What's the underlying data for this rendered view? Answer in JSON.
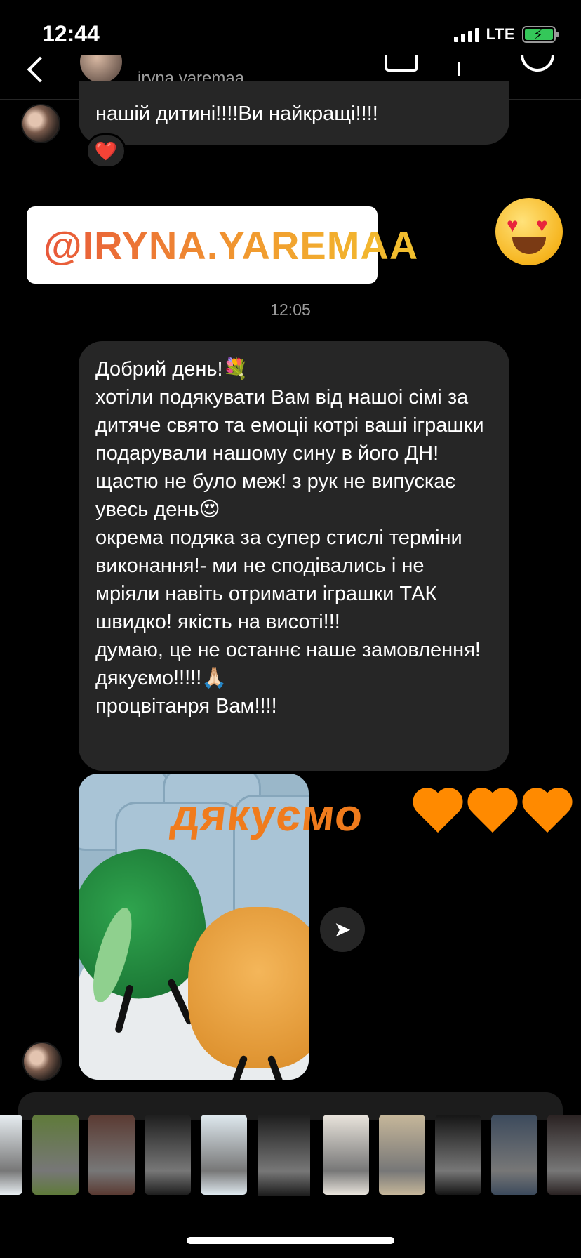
{
  "status_bar": {
    "time": "12:44",
    "network": "LTE",
    "battery_charging": true
  },
  "header": {
    "username": "iryna.yaremaa",
    "icons": [
      "back-icon",
      "video-call-icon",
      "info-icon",
      "emoji-icon"
    ]
  },
  "messages": {
    "top_text": "нашій дитині!!!!Ви найкращі!!!!",
    "top_reaction": "❤️",
    "mention_card": "@IRYNA.YAREMAA",
    "mention_reaction": "😍",
    "timestamp": "12:05",
    "main_lines": [
      "Добрий день!💐",
      "хотіли подякувати Вам від нашоі сімі за дитяче свято та емоціі котрі ваші іграшки подарували нашому сину в його ДН! щастю не було меж! з рук не випускає увесь день😍",
      "окрема подяка за супер стислі терміни виконання!- ми не сподівались і не мріяли навіть отримати іграшки ТАК швидко! якість на висоті!!!",
      "думаю, це не останнє наше замовлення! дякуємо!!!!!🙏🏻",
      "процвітанря Вам!!!!"
    ],
    "sticker_text": "дякуємо",
    "sticker_hearts": "🧡🧡🧡"
  },
  "thumbnails": [
    {
      "color": "#e8eef2"
    },
    {
      "color": "#5f7a3a"
    },
    {
      "color": "#5a3a32"
    },
    {
      "color": "#1e1e1e"
    },
    {
      "color": "#dfe9ef"
    },
    {
      "color": "#101010"
    },
    {
      "color": "#e9e4dc"
    },
    {
      "color": "#c6b79a"
    },
    {
      "color": "#151515"
    },
    {
      "color": "#3c4a5c"
    },
    {
      "color": "#2a2222"
    }
  ]
}
